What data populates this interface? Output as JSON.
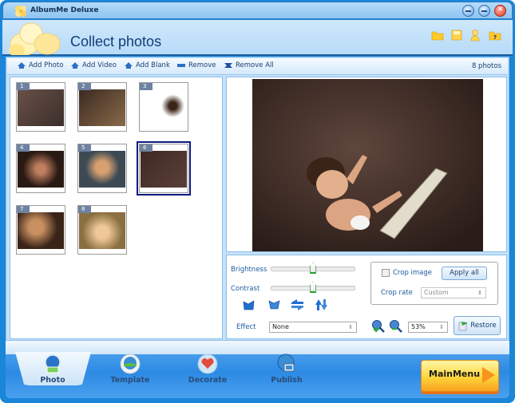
{
  "window": {
    "title": "AlbumMe Deluxe",
    "controls": [
      "minimize",
      "maximize",
      "close"
    ]
  },
  "header": {
    "page_title": "Collect photos",
    "icons": [
      "open-folder-icon",
      "save-icon",
      "user-icon",
      "help-icon"
    ]
  },
  "toolbar": {
    "buttons": [
      {
        "label": "Add Photo",
        "icon": "add-photo-icon"
      },
      {
        "label": "Add Video",
        "icon": "add-video-icon"
      },
      {
        "label": "Add Blank",
        "icon": "add-blank-icon"
      },
      {
        "label": "Remove",
        "icon": "remove-icon"
      },
      {
        "label": "Remove All",
        "icon": "remove-all-icon"
      }
    ],
    "photo_count": "8 photos"
  },
  "thumbnails": [
    {
      "number": "1",
      "selected": false
    },
    {
      "number": "2",
      "selected": false
    },
    {
      "number": "3",
      "selected": false
    },
    {
      "number": "4",
      "selected": false
    },
    {
      "number": "5",
      "selected": false
    },
    {
      "number": "6",
      "selected": true
    },
    {
      "number": "7",
      "selected": false
    },
    {
      "number": "8",
      "selected": false
    }
  ],
  "controls": {
    "brightness_label": "Brightness",
    "brightness_value": 0.5,
    "contrast_label": "Contrast",
    "contrast_value": 0.5,
    "rotate_buttons": [
      "flip-horizontal",
      "flip-vertical",
      "rotate-horizontal",
      "rotate-vertical"
    ],
    "effect_label": "Effect",
    "effect_value": "None",
    "crop_image_label": "Crop image",
    "crop_image_checked": false,
    "apply_all_label": "Apply all",
    "crop_rate_label": "Crop rate",
    "crop_rate_value": "Custom",
    "zoom_value": "53%",
    "restore_label": "Restore"
  },
  "nav": {
    "tabs": [
      {
        "label": "Photo",
        "active": true
      },
      {
        "label": "Template",
        "active": false
      },
      {
        "label": "Decorate",
        "active": false
      },
      {
        "label": "Publish",
        "active": false
      }
    ],
    "main_menu_label": "MainMenu"
  },
  "colors": {
    "frame_blue": "#1b86d8",
    "title_text": "#0f3f77",
    "label_blue": "#1b5a9e",
    "selection_outline": "#0d1a80",
    "main_menu_orange": "#f7941d"
  }
}
